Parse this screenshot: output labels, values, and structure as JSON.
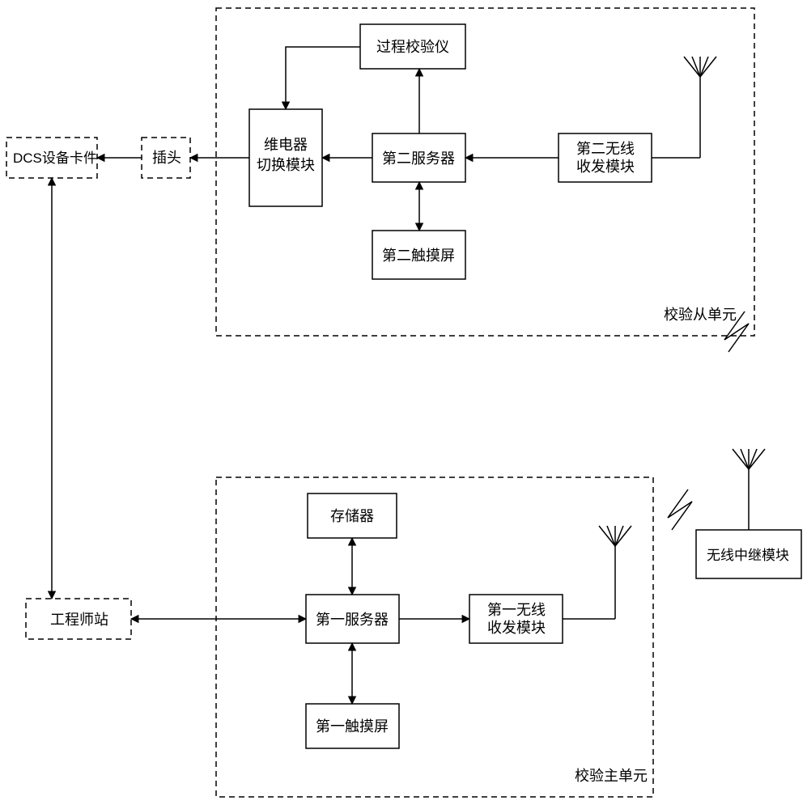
{
  "boxes": {
    "dcs_card": "DCS设备卡件",
    "plug": "插头",
    "relay_switch_l1": "维电器",
    "relay_switch_l2": "切换模块",
    "process_calibrator": "过程校验仪",
    "server2": "第二服务器",
    "touch2": "第二触摸屏",
    "wireless2_l1": "第二无线",
    "wireless2_l2": "收发模块",
    "engineer_station": "工程师站",
    "memory": "存储器",
    "server1": "第一服务器",
    "touch1": "第一触摸屏",
    "wireless1_l1": "第一无线",
    "wireless1_l2": "收发模块",
    "wireless_relay": "无线中继模块"
  },
  "group_labels": {
    "slave_unit": "校验从单元",
    "master_unit": "校验主单元"
  }
}
